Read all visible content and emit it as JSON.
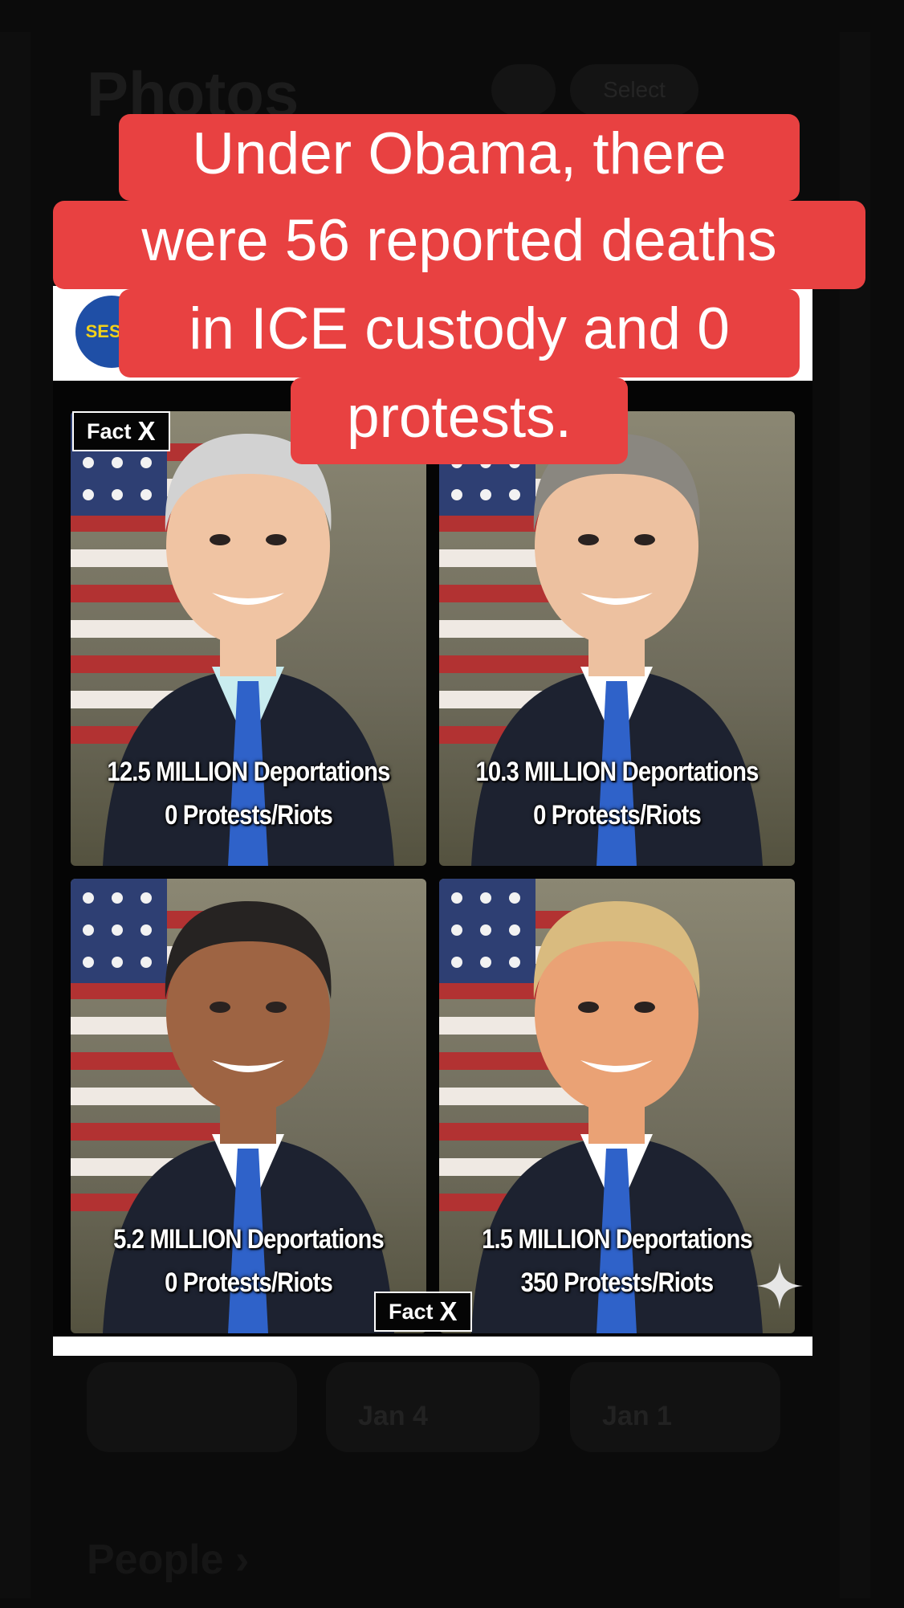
{
  "overlay_caption": {
    "lines": [
      "Under Obama, there",
      "were 56 reported deaths",
      "in ICE custody and 0",
      "protests."
    ],
    "background_color": "#e84141",
    "text_color": "#ffffff"
  },
  "background_app": {
    "title": "Photos",
    "select_label": "Select",
    "thumbnails": [
      "Jan 4",
      "Jan 1"
    ],
    "section_label": "People ›"
  },
  "post": {
    "logo_text": "SESSI",
    "fact_badge": {
      "label": "Fact",
      "mark": "X"
    },
    "panels": [
      {
        "deportations": "12.5 MILLION Deportations",
        "protests": "0 Protests/Riots",
        "hair_color": "#d2d2d2",
        "skin_color": "#f0c4a3",
        "tie_color": "#2f62c9",
        "shirt_color": "#c9ecef"
      },
      {
        "deportations": "10.3 MILLION Deportations",
        "protests": "0 Protests/Riots",
        "hair_color": "#8a8780",
        "skin_color": "#edc1a0",
        "tie_color": "#2f62c9",
        "shirt_color": "#ffffff"
      },
      {
        "deportations": "5.2 MILLION Deportations",
        "protests": "0 Protests/Riots",
        "hair_color": "#262322",
        "skin_color": "#9e6443",
        "tie_color": "#2f62c9",
        "shirt_color": "#ffffff"
      },
      {
        "deportations": "1.5 MILLION Deportations",
        "protests": "350 Protests/Riots",
        "hair_color": "#d9bb7f",
        "skin_color": "#eaa275",
        "tie_color": "#2f62c9",
        "shirt_color": "#ffffff"
      }
    ]
  }
}
